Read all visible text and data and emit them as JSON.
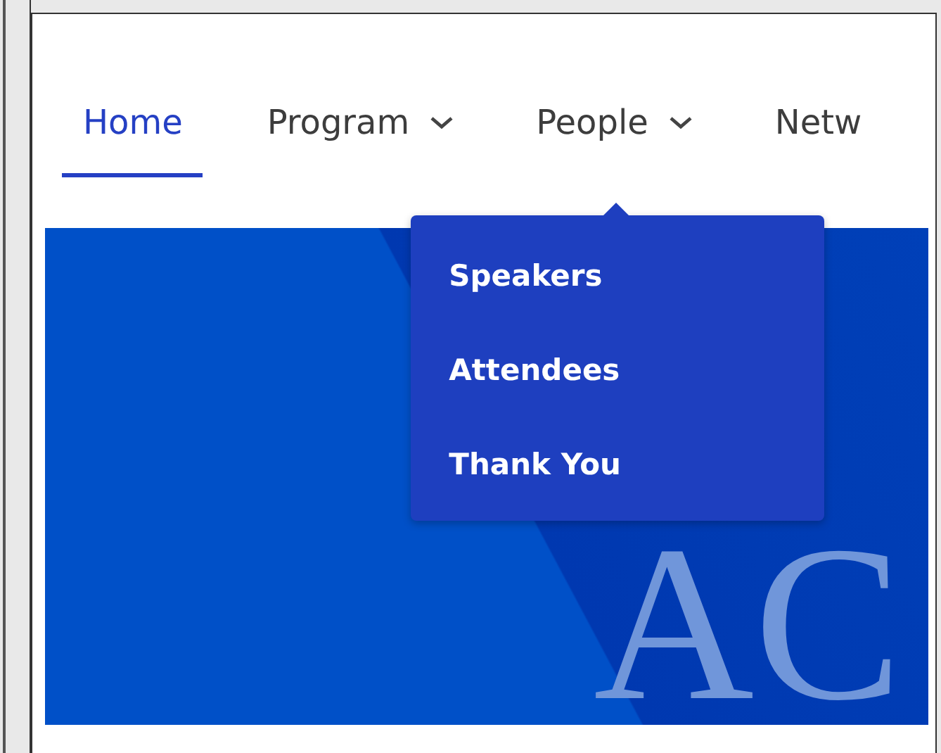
{
  "nav": {
    "items": [
      {
        "label": "Home",
        "selected": true,
        "has_menu": false
      },
      {
        "label": "Program",
        "selected": false,
        "has_menu": true
      },
      {
        "label": "People",
        "selected": false,
        "has_menu": true,
        "menu": [
          "Speakers",
          "Attendees",
          "Thank You"
        ]
      },
      {
        "label": "Netw",
        "selected": false,
        "has_menu": false
      }
    ]
  },
  "hero": {
    "title": "AC"
  }
}
